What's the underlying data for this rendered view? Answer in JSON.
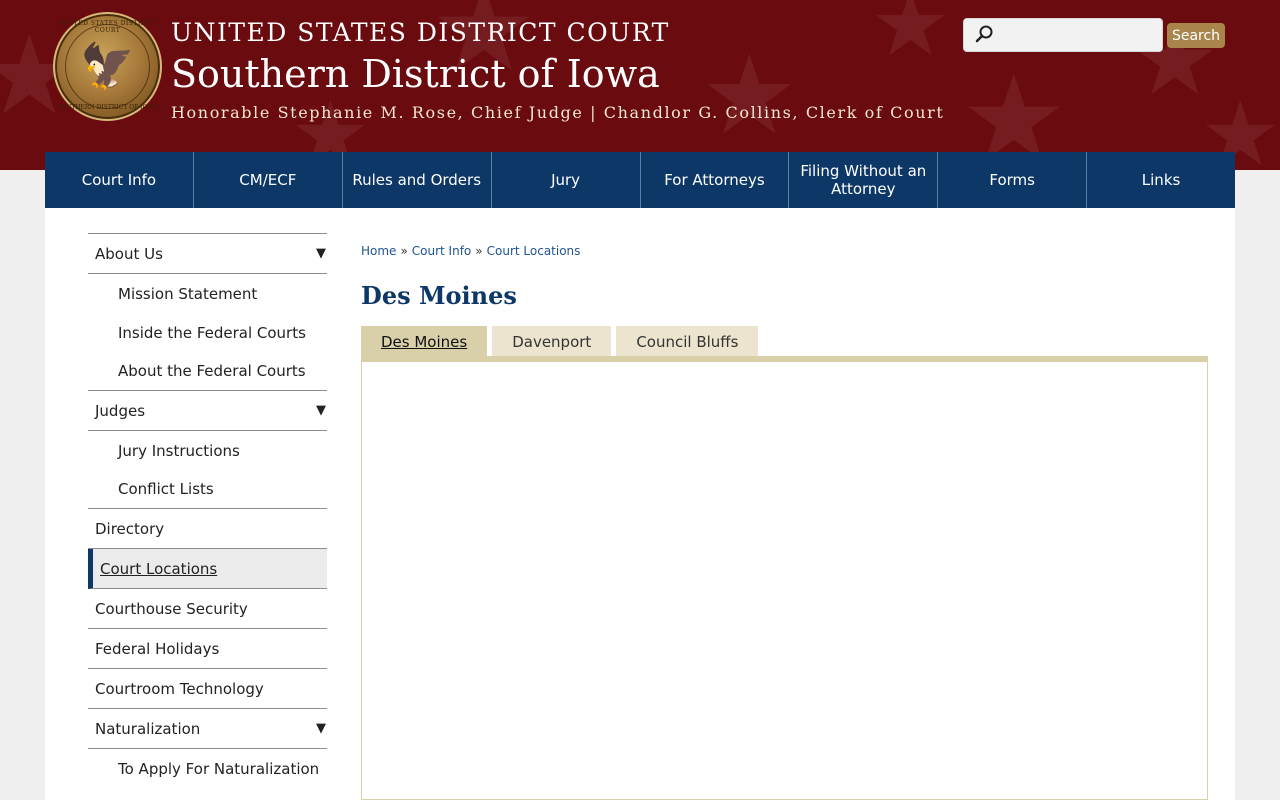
{
  "header": {
    "court_type": "UNITED STATES DISTRICT COURT",
    "district": "Southern District of Iowa",
    "officials": "Honorable Stephanie M. Rose, Chief Judge | Chandlor G. Collins, Clerk of Court",
    "seal_top": "UNITED STATES DISTRICT COURT",
    "seal_bottom": "SOUTHERN DISTRICT OF IOWA"
  },
  "search": {
    "placeholder": "",
    "value": "",
    "button_label": "Search"
  },
  "nav": [
    {
      "label": "Court Info"
    },
    {
      "label": "CM/ECF"
    },
    {
      "label": "Rules and Orders"
    },
    {
      "label": "Jury"
    },
    {
      "label": "For Attorneys"
    },
    {
      "label": "Filing Without an Attorney"
    },
    {
      "label": "Forms"
    },
    {
      "label": "Links"
    }
  ],
  "sidebar": {
    "about_us": "About Us",
    "mission": "Mission Statement",
    "inside": "Inside the Federal Courts",
    "about_federal": "About the Federal Courts",
    "judges": "Judges",
    "jury_instructions": "Jury Instructions",
    "conflict_lists": "Conflict Lists",
    "directory": "Directory",
    "court_locations": "Court Locations",
    "security": "Courthouse Security",
    "holidays": "Federal Holidays",
    "technology": "Courtroom Technology",
    "naturalization": "Naturalization",
    "apply_naturalization": "To Apply For Naturalization",
    "expand_glyph": "▼"
  },
  "breadcrumb": {
    "home": "Home",
    "court_info": "Court Info",
    "court_locations": "Court Locations",
    "separator": "»"
  },
  "page_title": "Des Moines",
  "tabs": [
    {
      "label": "Des Moines",
      "active": true
    },
    {
      "label": "Davenport",
      "active": false
    },
    {
      "label": "Council Bluffs",
      "active": false
    }
  ],
  "colors": {
    "header_bg": "#6a0b0f",
    "nav_bg": "#0c3766",
    "accent_gold": "#a9844b",
    "tab_active": "#d9cfa9",
    "link": "#205493"
  }
}
